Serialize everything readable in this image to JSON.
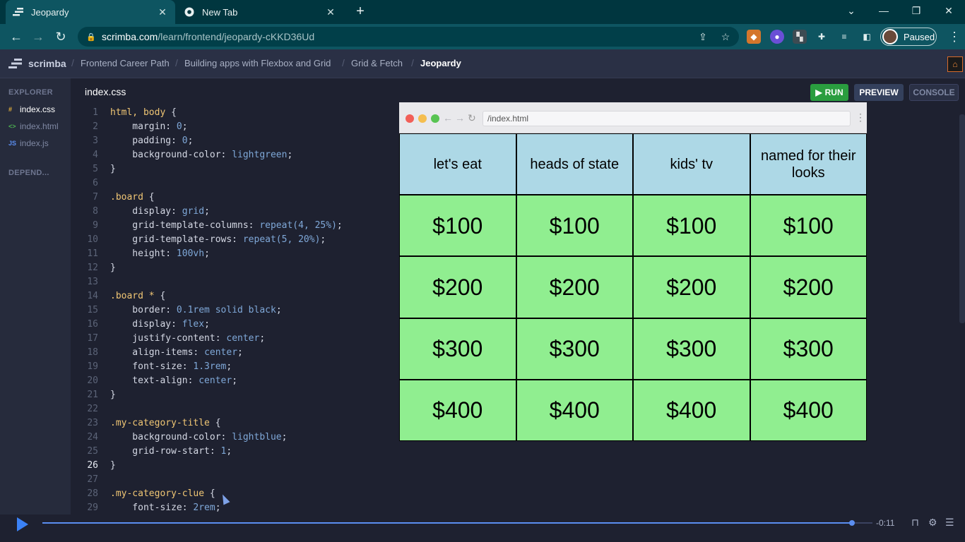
{
  "browser": {
    "tabs": [
      {
        "title": "Jeopardy",
        "icon": "scrimba-favicon"
      },
      {
        "title": "New Tab",
        "icon": "chrome-favicon"
      }
    ],
    "new_tab_symbol": "+",
    "url_host": "scrimba.com",
    "url_path": "/learn/frontend/jeopardy-cKKD36Ud",
    "profile_status": "Paused",
    "colors": {
      "tabbar": "#00363f",
      "toolbar": "#0e5561"
    }
  },
  "scrimba": {
    "logo_text": "scrimba",
    "breadcrumbs": [
      "Frontend Career Path",
      "Building apps with Flexbox and Grid",
      "Grid & Fetch",
      "Jeopardy"
    ],
    "crumb_separator": "/"
  },
  "sidebar": {
    "explorer_label": "EXPLORER",
    "dependencies_label": "DEPEND...",
    "files": [
      {
        "name": "index.css",
        "icon_text": "#",
        "icon_color": "#e8b23a",
        "active": true
      },
      {
        "name": "index.html",
        "icon_text": "<>",
        "icon_color": "#4caf50",
        "active": false
      },
      {
        "name": "index.js",
        "icon_text": "JS",
        "icon_color": "#5b8ef0",
        "active": false
      }
    ]
  },
  "editor": {
    "filename": "index.css",
    "current_line": 26,
    "run_label": "RUN",
    "preview_label": "PREVIEW",
    "console_label": "CONSOLE",
    "lines": [
      [
        [
          "sel",
          "html, body"
        ],
        [
          "br",
          " {"
        ]
      ],
      [
        [
          "prop",
          "    margin: "
        ],
        [
          "val",
          "0"
        ],
        [
          "br",
          ";"
        ]
      ],
      [
        [
          "prop",
          "    padding: "
        ],
        [
          "val",
          "0"
        ],
        [
          "br",
          ";"
        ]
      ],
      [
        [
          "prop",
          "    background-color: "
        ],
        [
          "val",
          "lightgreen"
        ],
        [
          "br",
          ";"
        ]
      ],
      [
        [
          "br",
          "}"
        ]
      ],
      [],
      [
        [
          "sel",
          ".board"
        ],
        [
          "br",
          " {"
        ]
      ],
      [
        [
          "prop",
          "    display: "
        ],
        [
          "val",
          "grid"
        ],
        [
          "br",
          ";"
        ]
      ],
      [
        [
          "prop",
          "    grid-template-columns: "
        ],
        [
          "val",
          "repeat(4, 25%)"
        ],
        [
          "br",
          ";"
        ]
      ],
      [
        [
          "prop",
          "    grid-template-rows: "
        ],
        [
          "val",
          "repeat(5, 20%)"
        ],
        [
          "br",
          ";"
        ]
      ],
      [
        [
          "prop",
          "    height: "
        ],
        [
          "val",
          "100vh"
        ],
        [
          "br",
          ";"
        ]
      ],
      [
        [
          "br",
          "}"
        ]
      ],
      [],
      [
        [
          "sel",
          ".board * "
        ],
        [
          "br",
          "{"
        ]
      ],
      [
        [
          "prop",
          "    border: "
        ],
        [
          "val",
          "0.1rem solid black"
        ],
        [
          "br",
          ";"
        ]
      ],
      [
        [
          "prop",
          "    display: "
        ],
        [
          "val",
          "flex"
        ],
        [
          "br",
          ";"
        ]
      ],
      [
        [
          "prop",
          "    justify-content: "
        ],
        [
          "val",
          "center"
        ],
        [
          "br",
          ";"
        ]
      ],
      [
        [
          "prop",
          "    align-items: "
        ],
        [
          "val",
          "center"
        ],
        [
          "br",
          ";"
        ]
      ],
      [
        [
          "prop",
          "    font-size: "
        ],
        [
          "val",
          "1.3rem"
        ],
        [
          "br",
          ";"
        ]
      ],
      [
        [
          "prop",
          "    text-align: "
        ],
        [
          "val",
          "center"
        ],
        [
          "br",
          ";"
        ]
      ],
      [
        [
          "br",
          "}"
        ]
      ],
      [],
      [
        [
          "sel",
          ".my-category-title"
        ],
        [
          "br",
          " {"
        ]
      ],
      [
        [
          "prop",
          "    background-color: "
        ],
        [
          "val",
          "lightblue"
        ],
        [
          "br",
          ";"
        ]
      ],
      [
        [
          "prop",
          "    grid-row-start: "
        ],
        [
          "val",
          "1"
        ],
        [
          "br",
          ";"
        ]
      ],
      [
        [
          "br",
          "}"
        ]
      ],
      [],
      [
        [
          "sel",
          ".my-category-clue"
        ],
        [
          "br",
          " {"
        ]
      ],
      [
        [
          "prop",
          "    font-size: "
        ],
        [
          "val",
          "2rem"
        ],
        [
          "br",
          ";"
        ]
      ]
    ]
  },
  "preview": {
    "url": "/index.html",
    "categories": [
      "let's eat",
      "heads of state",
      "kids' tv",
      "named for their looks"
    ],
    "clue_rows": [
      [
        "$100",
        "$100",
        "$100",
        "$100"
      ],
      [
        "$200",
        "$200",
        "$200",
        "$200"
      ],
      [
        "$300",
        "$300",
        "$300",
        "$300"
      ],
      [
        "$400",
        "$400",
        "$400",
        "$400"
      ]
    ],
    "colors": {
      "title_bg": "#add8e6",
      "clue_bg": "#90ee90"
    }
  },
  "player": {
    "time_remaining": "-0:11",
    "progress": 0.975
  }
}
